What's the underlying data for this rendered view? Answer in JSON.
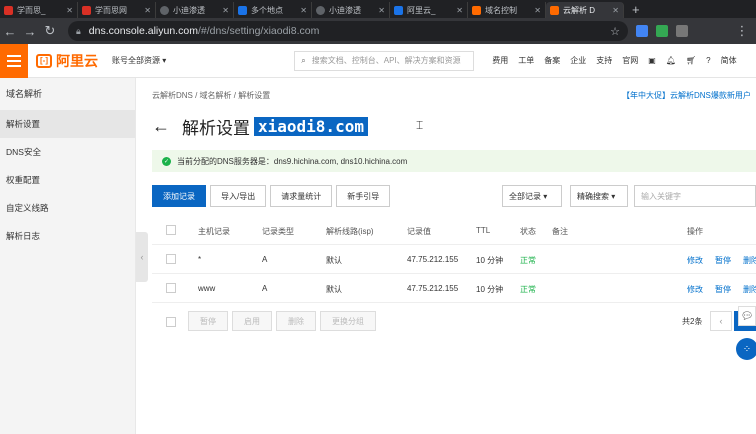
{
  "browser": {
    "tabs": [
      {
        "label": "学而思_",
        "color": "#d93025",
        "active": false
      },
      {
        "label": "学而思网",
        "color": "#d93025",
        "active": false
      },
      {
        "label": "小迪渗透",
        "color": "#5f6368",
        "active": false
      },
      {
        "label": "多个地点",
        "color": "#1a73e8",
        "active": false
      },
      {
        "label": "小迪渗透",
        "color": "#5f6368",
        "active": false
      },
      {
        "label": "阿里云_",
        "color": "#1a73e8",
        "active": false
      },
      {
        "label": "域名控制",
        "color": "#ff6a00",
        "active": false
      },
      {
        "label": "云解析 D",
        "color": "#ff6a00",
        "active": true
      }
    ],
    "new_tab": "+",
    "url_host": "dns.console.aliyun.com",
    "url_path": "/#/dns/setting/xiaodi8.com"
  },
  "console": {
    "logo_text": "阿里云",
    "account": "账号全部资源 ▾",
    "search_placeholder": "搜索文档、控制台、API、解决方案和资源",
    "nav": [
      "费用",
      "工单",
      "备案",
      "企业",
      "支持",
      "官网"
    ],
    "lang": "简体"
  },
  "sidebar": {
    "title": "域名解析",
    "items": [
      {
        "label": "解析设置",
        "active": true
      },
      {
        "label": "DNS安全",
        "active": false
      },
      {
        "label": "权重配置",
        "active": false
      },
      {
        "label": "自定义线路",
        "active": false
      },
      {
        "label": "解析日志",
        "active": false
      }
    ]
  },
  "main": {
    "breadcrumb": "云解析DNS  /  域名解析  /  解析设置",
    "promo": "【年中大促】云解析DNS爆款新用户",
    "title": "解析设置",
    "domain": "xiaodi8.com",
    "notice": "当前分配的DNS服务器是：dns9.hichina.com, dns10.hichina.com",
    "toolbar": {
      "add": "添加记录",
      "import": "导入/导出",
      "stats": "请求量统计",
      "guide": "新手引导",
      "filter_all": "全部记录 ▾",
      "filter_search": "精确搜索 ▾",
      "keyword_placeholder": "输入关键字"
    },
    "table": {
      "headers": [
        "主机记录",
        "记录类型",
        "解析线路(isp)",
        "记录值",
        "TTL",
        "状态",
        "备注",
        "操作"
      ],
      "rows": [
        {
          "host": "*",
          "type": "A",
          "line": "默认",
          "value": "47.75.212.155",
          "ttl": "10 分钟",
          "status": "正常",
          "note": "",
          "ops": [
            "修改",
            "暂停",
            "删除"
          ]
        },
        {
          "host": "www",
          "type": "A",
          "line": "默认",
          "value": "47.75.212.155",
          "ttl": "10 分钟",
          "status": "正常",
          "note": "",
          "ops": [
            "修改",
            "暂停",
            "删除"
          ]
        }
      ]
    },
    "footer": {
      "buttons": [
        "暂停",
        "启用",
        "删除",
        "更换分组"
      ],
      "total": "共2条"
    }
  }
}
